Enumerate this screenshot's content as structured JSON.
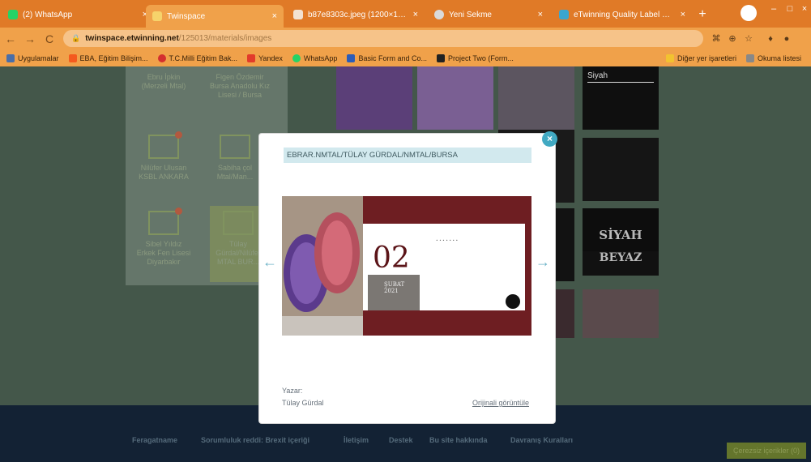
{
  "tabs": [
    {
      "title": "(2) WhatsApp",
      "close": "×",
      "color": "#25d366"
    },
    {
      "title": "Twinspace",
      "close": "×",
      "color": "#f6d36b",
      "active": true
    },
    {
      "title": "b87e8303c.jpeg (1200×1600)",
      "close": "×",
      "color": "#ffffff"
    },
    {
      "title": "Yeni Sekme",
      "close": "×",
      "color": "#cfcfcf"
    },
    {
      "title": "eTwinning Quality Label Rejn",
      "close": "×",
      "color": "#3aa6d0"
    }
  ],
  "new_tab": "+",
  "window": {
    "minimize": "–",
    "maximize": "□",
    "close": "×"
  },
  "nav": {
    "back": "←",
    "forward": "→",
    "reload": "C"
  },
  "address": {
    "lock": "🔒",
    "host": "twinspace.etwinning.net",
    "path": "/125013/materials/images"
  },
  "toolbar_icons": [
    "⌘",
    "⊕",
    "☆",
    "♦",
    "●"
  ],
  "bookmarks": [
    {
      "label": "Uygulamalar",
      "color": "#4a6ea8"
    },
    {
      "label": "EBA, Eğitim Bilişim...",
      "color": "#f45a1e"
    },
    {
      "label": "T.C.Milli Eğitim Bak...",
      "color": "#d42f2f"
    },
    {
      "label": "Yandex",
      "color": "#e23b2b"
    },
    {
      "label": "WhatsApp",
      "color": "#25d366"
    },
    {
      "label": "Basic Form and Co...",
      "color": "#2b5cb8"
    },
    {
      "label": "Project Two (Form...",
      "color": "#222222"
    }
  ],
  "bookmarks_right": [
    {
      "label": "Diğer yer işaretleri",
      "color": "#f2c230"
    },
    {
      "label": "Okuma listesi",
      "color": "#888888"
    }
  ],
  "gallery_left": [
    {
      "label": "Ebru İpkin (Merzeli Mtal)"
    },
    {
      "label": "Figen Özdemir Bursa Anadolu Kız Lisesi / Bursa"
    },
    {
      "label": "Nilüfer Ulusan KSBL ANKARA"
    },
    {
      "label": "Sabiha çol Mtal/Man..."
    },
    {
      "label": "Sibel Yıldız Erkek Fen Lisesi Diyarbakır"
    },
    {
      "label": "Tülay Gürdal/Nilüfer MTAL BUR..."
    }
  ],
  "grid_texts": {
    "siyah_1": "Siyah",
    "siyah_2": "SİYAH",
    "beyaz": "BEYAZ"
  },
  "modal": {
    "caption": "EBRAR.NMTAL/TÜLAY GÜRDAL/NMTAL/BURSA",
    "close": "×",
    "prev": "←",
    "next": "→",
    "image_day": "02",
    "image_month": "ŞUBAT 2021",
    "author_label": "Yazar:",
    "author_name": "Tülay Gürdal",
    "original_link": "Orijinali görüntüle"
  },
  "footer_links": [
    "Feragatname",
    "Sorumluluk reddi: Brexit içeriği",
    "İletişim",
    "Destek",
    "Bu site hakkında",
    "Davranış Kuralları"
  ],
  "cookie_button": "Çerezsiz içerikler (0)"
}
